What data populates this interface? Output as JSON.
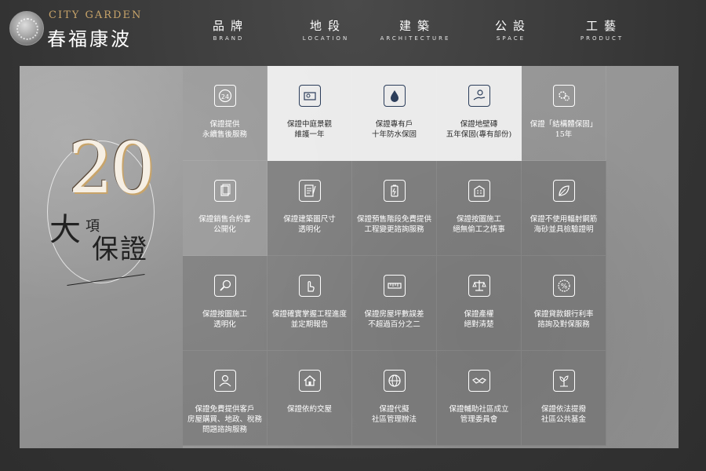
{
  "logo": {
    "en": "CITY GARDEN",
    "zh": "春福康波"
  },
  "nav": [
    {
      "zh": "品牌",
      "en": "BRAND"
    },
    {
      "zh": "地段",
      "en": "LOCATION"
    },
    {
      "zh": "建築",
      "en": "ARCHITECTURE"
    },
    {
      "zh": "公設",
      "en": "SPACE"
    },
    {
      "zh": "工藝",
      "en": "PRODUCT"
    }
  ],
  "hero": {
    "number": "20",
    "da": "大",
    "xiang": "項",
    "baozheng": "保證"
  },
  "guarantees": [
    {
      "icon": "24h-icon",
      "text": "保證提供\n永續售後服務",
      "style": "mid"
    },
    {
      "icon": "landscape-icon",
      "text": "保證中庭景觀\n維護一年",
      "style": "light"
    },
    {
      "icon": "water-drop-icon",
      "text": "保證專有戶\n十年防水保固",
      "style": "light"
    },
    {
      "icon": "hand-coin-icon",
      "text": "保證地壁磚\n五年保固(專有部份)",
      "style": "light"
    },
    {
      "icon": "gears-icon",
      "text": "保證「結構體保固」\n15年",
      "style": "mid"
    },
    {
      "icon": "document-icon",
      "text": "保證銷售合約書\n公開化",
      "style": "mid"
    },
    {
      "icon": "blueprint-icon",
      "text": "保證建築圖尺寸\n透明化",
      "style": "dark"
    },
    {
      "icon": "battery-icon",
      "text": "保證預售階段免費提供\n工程變更諮詢服務",
      "style": "dark"
    },
    {
      "icon": "building-icon",
      "text": "保證按圖施工\n絕無偷工之情事",
      "style": "dark"
    },
    {
      "icon": "leaf-icon",
      "text": "保證不使用輻射鋼筋\n海砂並具檢驗證明",
      "style": "dark"
    },
    {
      "icon": "magnifier-icon",
      "text": "保證按圖施工\n透明化",
      "style": "dark"
    },
    {
      "icon": "pointer-icon",
      "text": "保證確實掌握工程進度\n並定期報告",
      "style": "dark"
    },
    {
      "icon": "ruler-icon",
      "text": "保證房屋坪數誤差\n不超過百分之二",
      "style": "dark"
    },
    {
      "icon": "scale-icon",
      "text": "保證產權\n絕對清楚",
      "style": "dark"
    },
    {
      "icon": "percent-icon",
      "text": "保證貸款銀行利率\n諮詢及對保服務",
      "style": "dark"
    },
    {
      "icon": "consultant-icon",
      "text": "保證免費提供客戶\n房屋購買、地政、稅務\n問題諮詢服務",
      "style": "dark"
    },
    {
      "icon": "house-icon",
      "text": "保證依約交屋",
      "style": "dark"
    },
    {
      "icon": "globe-icon",
      "text": "保證代擬\n社區管理辦法",
      "style": "dark"
    },
    {
      "icon": "handshake-icon",
      "text": "保證輔助社區成立\n管理委員會",
      "style": "dark"
    },
    {
      "icon": "money-plant-icon",
      "text": "保證依法提撥\n社區公共基金",
      "style": "dark"
    }
  ]
}
